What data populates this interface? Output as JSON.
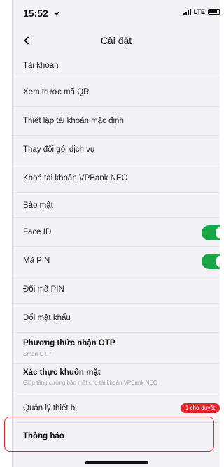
{
  "status_bar": {
    "time": "15:52",
    "network": "LTE"
  },
  "nav": {
    "title": "Cài đặt",
    "back_icon": "chevron-left-icon"
  },
  "sections": {
    "account": {
      "title": "Tài khoản",
      "items": [
        {
          "label": "Xem trước mã QR"
        },
        {
          "label": "Thiết lập tài khoản mặc định"
        },
        {
          "label": "Thay đổi gói dịch vụ"
        },
        {
          "label": "Khoá tài khoản VPBank NEO"
        }
      ]
    },
    "security": {
      "title": "Bảo mật",
      "face_id": {
        "label": "Face ID",
        "enabled": true
      },
      "pin": {
        "label": "Mã PIN",
        "enabled": true
      },
      "change_pin": {
        "label": "Đổi mã PIN"
      },
      "change_password": {
        "label": "Đổi mật khẩu"
      },
      "otp": {
        "title": "Phương thức nhận OTP",
        "subtitle": "Smart OTP"
      },
      "face_auth": {
        "title": "Xác thực khuôn mặt",
        "subtitle": "Giúp tăng cường bảo mật cho tài khoản VPBank NEO"
      },
      "devices": {
        "label": "Quản lý thiết bị",
        "badge": "1 chờ duyệt"
      }
    },
    "notifications": {
      "title": "Thông báo"
    }
  },
  "colors": {
    "toggle_on": "#1aa647",
    "badge": "#e0262d",
    "highlight_border": "#d9282f",
    "background": "#f2f2f7"
  }
}
